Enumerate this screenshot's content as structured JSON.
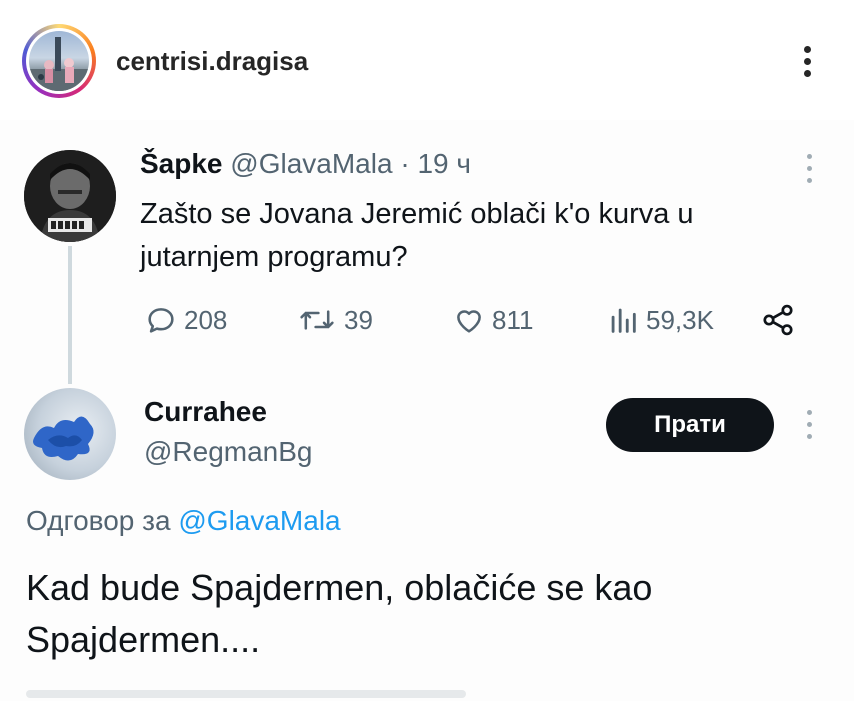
{
  "ig_header": {
    "username": "centrisi.dragisa",
    "more_icon": "more-vertical-icon"
  },
  "tweet": {
    "author_name": "Šapke",
    "author_handle": "@GlavaMala",
    "separator": "·",
    "time": "19 ч",
    "text_lines": [
      "Zašto se Jovana Jeremić oblači k'o kurva u",
      "jutarnjem programu?"
    ],
    "stats": {
      "replies": "208",
      "reposts": "39",
      "likes": "811",
      "views": "59,3K"
    },
    "icons": [
      "reply-icon",
      "repost-icon",
      "like-icon",
      "views-icon",
      "share-icon"
    ]
  },
  "reply": {
    "author_name": "Currahee",
    "author_handle": "@RegmanBg",
    "follow_label": "Прати",
    "reply_to_label": "Одговор за",
    "reply_to_handle": "@GlavaMala",
    "text_lines": [
      "Kad bude Spajdermen, oblačiće se kao",
      "Spajdermen...."
    ]
  },
  "colors": {
    "text": "#0f1419",
    "secondary": "#536471",
    "link": "#1d9bf0",
    "button_bg": "#0f1419",
    "thread_line": "#cfd9de"
  }
}
